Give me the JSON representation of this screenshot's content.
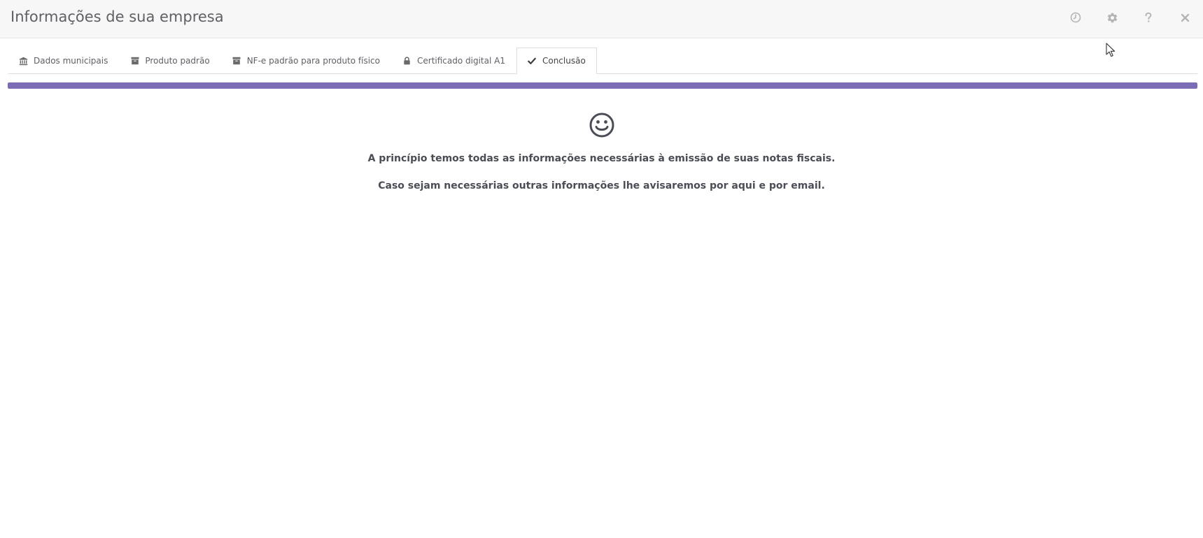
{
  "window": {
    "title": "Informações de sua empresa"
  },
  "header_icons": [
    {
      "name": "clock-icon"
    },
    {
      "name": "gear-icon"
    },
    {
      "name": "question-icon"
    },
    {
      "name": "close-icon"
    }
  ],
  "tabs": [
    {
      "label": "Dados municipais",
      "icon": "bank-icon",
      "active": false
    },
    {
      "label": "Produto padrão",
      "icon": "archive-icon",
      "active": false
    },
    {
      "label": "NF-e padrão para produto físico",
      "icon": "archive-icon",
      "active": false
    },
    {
      "label": "Certificado digital A1",
      "icon": "lock-icon",
      "active": false
    },
    {
      "label": "Conclusão",
      "icon": "check-icon",
      "active": true
    }
  ],
  "progress": {
    "percent": 100,
    "color": "#7c6bb5"
  },
  "content": {
    "icon": "smile-icon",
    "message_1": "A princípio temos todas as informações necessárias à emissão de suas notas fiscais.",
    "message_2": "Caso sejam necessárias outras informações lhe avisaremos por aqui e por email."
  }
}
